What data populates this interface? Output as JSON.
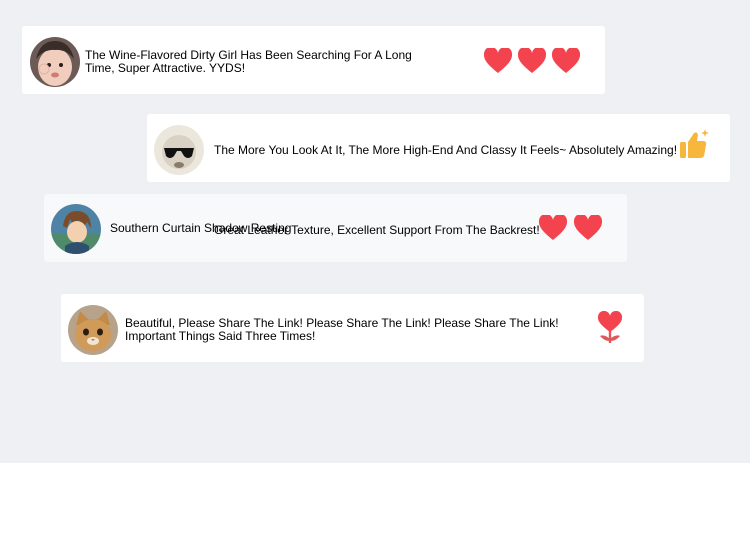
{
  "comments": [
    {
      "text": "The Wine-Flavored Dirty Girl Has Been Searching For A Long Time, Super Attractive. YYDS!",
      "avatar": "child-photo-avatar",
      "icons": [
        "heart-icon",
        "heart-icon",
        "heart-icon"
      ]
    },
    {
      "text": "The More You Look At It, The More High-End And Classy It Feels~ Absolutely Amazing!",
      "avatar": "sunglasses-avatar",
      "icons": [
        "thumbs-up-icon"
      ]
    },
    {
      "name": "Southern Curtain Shadow Resting",
      "text": "Great Leather Texture, Excellent Support From The Backrest!",
      "avatar": "anime-character-avatar",
      "icons": [
        "heart-icon",
        "heart-icon"
      ]
    },
    {
      "text": "Beautiful, Please Share The Link! Please Share The Link! Please Share The Link! Important Things Said Three Times!",
      "avatar": "cat-avatar",
      "icons": [
        "heart-flower-icon"
      ]
    }
  ],
  "colors": {
    "background": "#eef0f3",
    "card": "#ffffff",
    "heart": "#f2434f",
    "thumbs_up": "#f6b73c"
  }
}
